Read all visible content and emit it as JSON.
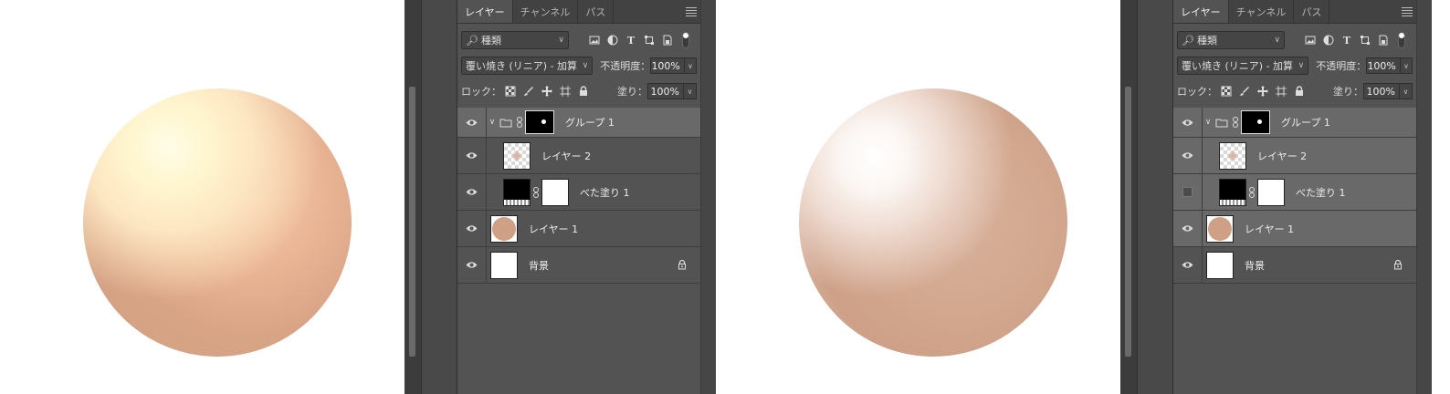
{
  "tabs": [
    "レイヤー",
    "チャンネル",
    "パス"
  ],
  "filter": {
    "label": "種類"
  },
  "blend_mode": "覆い焼き (リニア) - 加算",
  "opacity": {
    "label": "不透明度：",
    "value": "100%"
  },
  "lock": {
    "label": "ロック："
  },
  "fill": {
    "label": "塗り：",
    "value": "100%"
  },
  "layers": [
    "グループ 1",
    "レイヤー 2",
    "べた塗り 1",
    "レイヤー 1",
    "背景"
  ],
  "colors": {
    "panel": "#535353",
    "selected": "#696969",
    "tabbar": "#424242"
  }
}
